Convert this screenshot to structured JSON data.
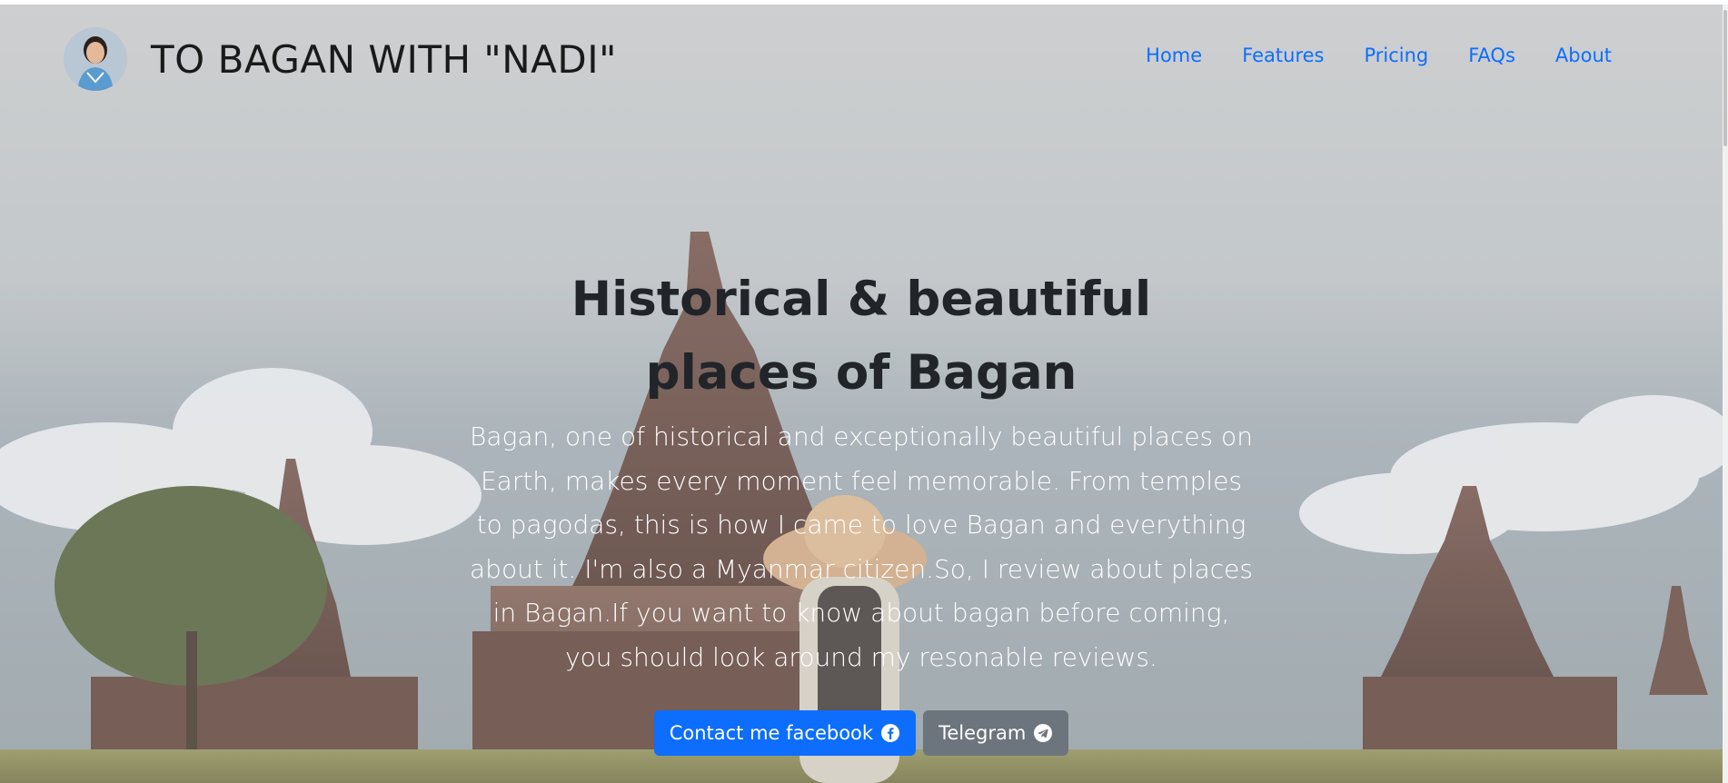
{
  "brand": {
    "title": "TO BAGAN WITH \"NADI\"",
    "avatar_icon": "profile-photo"
  },
  "nav": {
    "items": [
      {
        "label": "Home"
      },
      {
        "label": "Features"
      },
      {
        "label": "Pricing"
      },
      {
        "label": "FAQs"
      },
      {
        "label": "About"
      }
    ]
  },
  "hero": {
    "title": "Historical & beautiful places of Bagan",
    "lead": "Bagan, one of historical and exceptionally beautiful places on Earth, makes every moment feel memorable. From temples to pagodas, this is how I came to love Bagan and everything about it. I'm also a Myanmar citizen.So, I review about places in Bagan.If you want to know about bagan before coming, you should look around my resonable reviews.",
    "buttons": {
      "facebook_label": "Contact me facebook",
      "facebook_icon": "facebook-icon",
      "telegram_label": "Telegram",
      "telegram_icon": "telegram-icon"
    }
  },
  "colors": {
    "link": "#0d6efd",
    "primary_button": "#0d6efd",
    "secondary_button": "#6c757d",
    "heading": "#212529"
  }
}
